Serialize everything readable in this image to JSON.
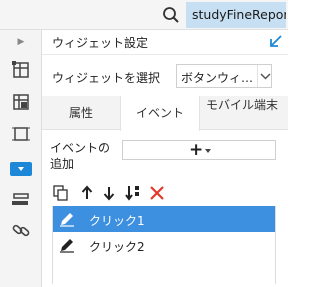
{
  "topbar": {
    "user_label": "studyFineReport"
  },
  "sidebar": {
    "icons": [
      "chevron-right-icon",
      "table-layout-icon",
      "dataset-icon",
      "border-frame-icon",
      "widget-dropdown-icon",
      "list-layers-icon",
      "link-icon"
    ],
    "active_icon": "widget-dropdown-icon",
    "accent_color": "#1e88d8"
  },
  "panel": {
    "title": "ウィジェット設定",
    "select_label": "ウィジェットを選択",
    "select_value": "ボタンウィ…",
    "tabs": [
      {
        "label": "属性",
        "active": false
      },
      {
        "label": "イベント",
        "active": true
      },
      {
        "label": "モバイル端末",
        "active": false
      }
    ],
    "add_event_label": "イベントの追加",
    "add_button_label": "+"
  },
  "toolbar": {
    "icons": [
      "copy-icon",
      "move-up-icon",
      "move-down-icon",
      "sort-icon",
      "delete-icon"
    ]
  },
  "events": [
    {
      "label": "クリック1",
      "selected": true
    },
    {
      "label": "クリック2",
      "selected": false
    }
  ],
  "colors": {
    "selection": "#3d8fe0",
    "user_chip": "#c6dff2",
    "delete": "#e0392b"
  }
}
